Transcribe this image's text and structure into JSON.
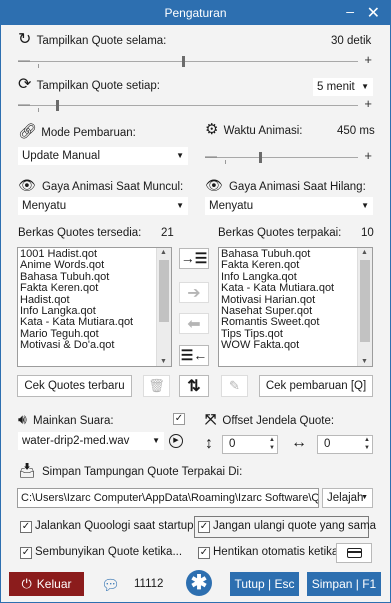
{
  "window": {
    "title": "Pengaturan",
    "minimize_glyph": "–",
    "close_glyph": "✕"
  },
  "quote_duration": {
    "label": "Tampilkan Quote selama:",
    "value": "30 detik",
    "icon": "refresh-icon"
  },
  "quote_interval": {
    "label": "Tampilkan Quote setiap:",
    "value": "5 menit",
    "icon": "sync-icon"
  },
  "update_mode": {
    "label": "Mode Pembaruan:",
    "value": "Update Manual",
    "icon": "link-icon"
  },
  "animation_time": {
    "label": "Waktu Animasi:",
    "value": "450 ms",
    "icon": "gears-icon"
  },
  "anim_show": {
    "label": "Gaya Animasi Saat Muncul:",
    "value": "Menyatu",
    "icon": "eye-icon"
  },
  "anim_hide": {
    "label": "Gaya Animasi Saat Hilang:",
    "value": "Menyatu",
    "icon": "eye-icon"
  },
  "available": {
    "label": "Berkas Quotes tersedia:",
    "count": "21",
    "items": [
      "1001 Hadist.qot",
      "Anime Words.qot",
      "Bahasa Tubuh.qot",
      "Fakta Keren.qot",
      "Hadist.qot",
      "Info Langka.qot",
      "Kata - Kata Mutiara.qot",
      "Mario Teguh.qot",
      "Motivasi & Do'a.qot"
    ]
  },
  "used": {
    "label": "Berkas Quotes terpakai:",
    "count": "10",
    "items": [
      "Bahasa Tubuh.qot",
      "Fakta Keren.qot",
      "Info Langka.qot",
      "Kata - Kata Mutiara.qot",
      "Motivasi Harian.qot",
      "Nasehat Super.qot",
      "Romantis Sweet.qot",
      "Tips Tips.qot",
      "WOW Fakta.qot"
    ]
  },
  "buttons": {
    "check_quotes": "Cek Quotes terbaru",
    "check_update": "Cek pembaruan [Q]",
    "exit": "Keluar",
    "close_esc": "Tutup | Esc",
    "save": "Simpan | F1",
    "browse": "Jelajah"
  },
  "sound": {
    "label": "Mainkan Suara:",
    "file": "water-drip2-med.wav",
    "checked": true
  },
  "offset": {
    "label": "Offset Jendela Quote:",
    "vertical": "0",
    "horizontal": "0"
  },
  "storage": {
    "label": "Simpan Tampungan Quote Terpakai Di:",
    "path": "C:\\Users\\Izarc Computer\\AppData\\Roaming\\Izarc Software\\Q"
  },
  "options": {
    "run_startup": "Jalankan Quoologi saat startup",
    "no_repeat": "Jangan ulangi quote yang sama",
    "hide_quote": "Sembunyikan Quote ketika...",
    "auto_stop": "Hentikan otomatis ketika"
  },
  "footer": {
    "count": "11112"
  },
  "colors": {
    "titlebar": "#2d6fb0",
    "exit": "#8b1c1c",
    "primary": "#2d6fb0"
  }
}
